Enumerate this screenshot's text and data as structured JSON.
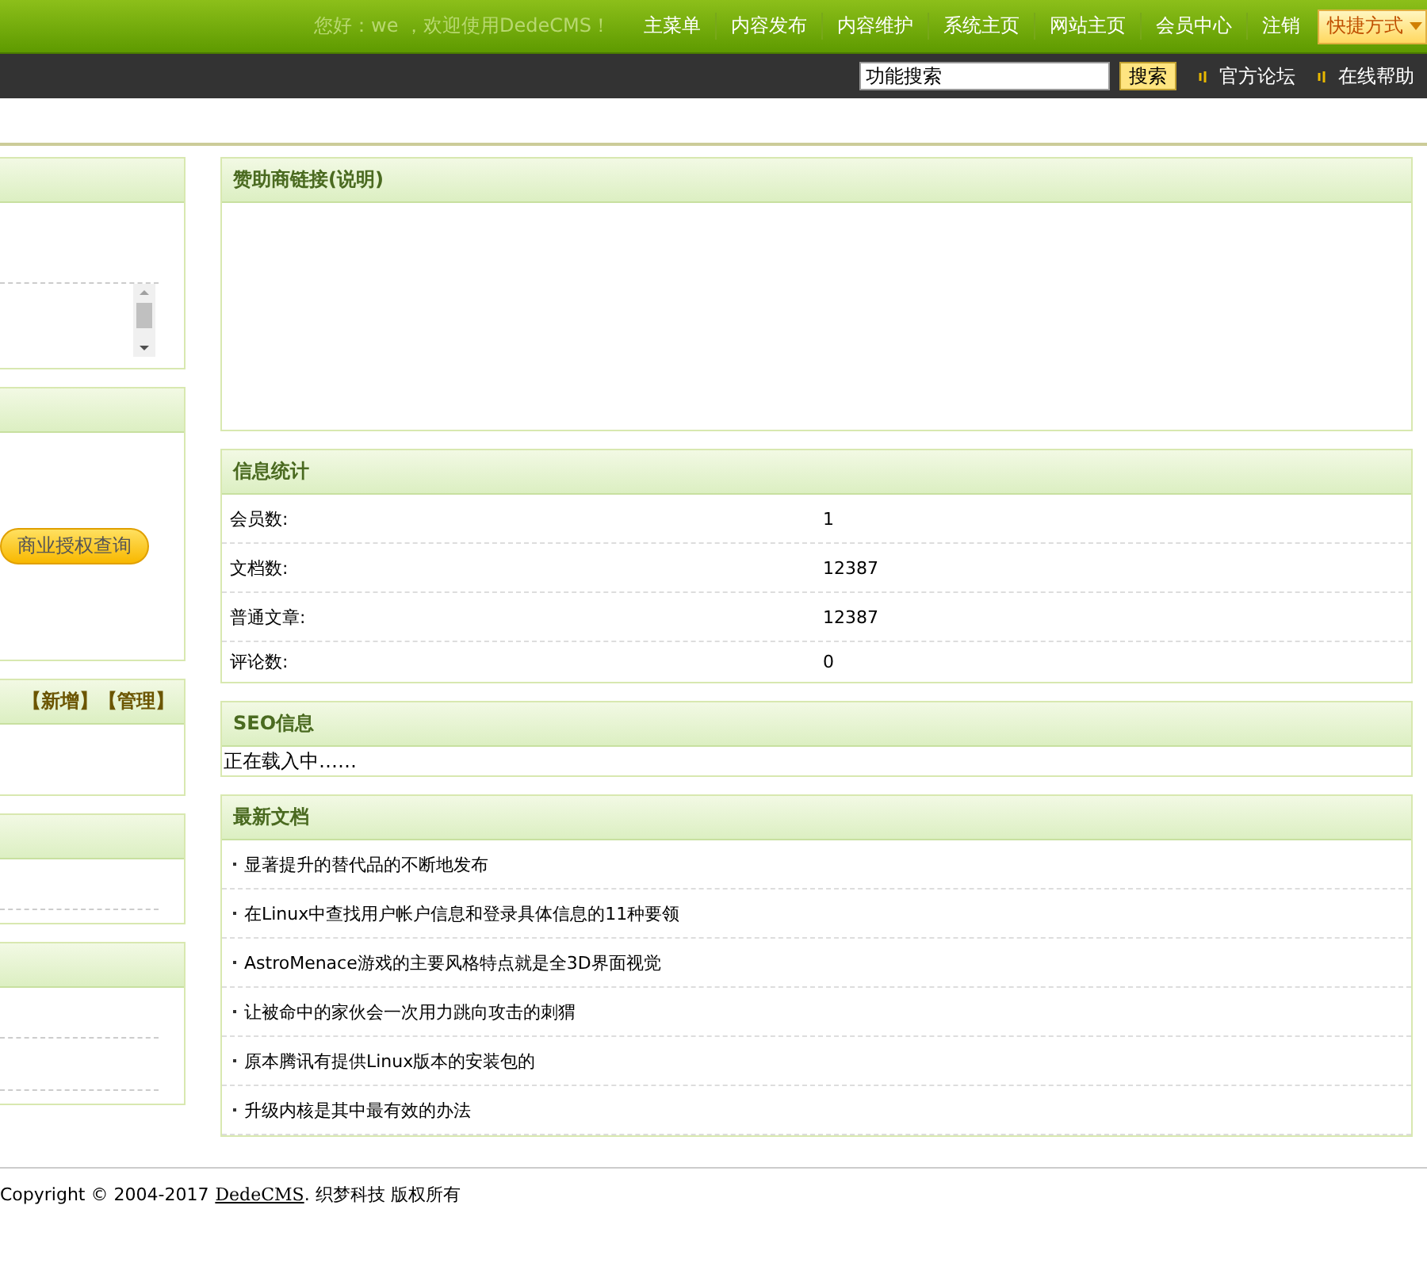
{
  "header": {
    "greeting": "您好：we ，欢迎使用DedeCMS！",
    "nav": [
      "主菜单",
      "内容发布",
      "内容维护",
      "系统主页",
      "网站主页",
      "会员中心",
      "注销"
    ],
    "shortcut": "快捷方式"
  },
  "toolbar": {
    "search_value": "功能搜索",
    "search_button": "搜索",
    "links": [
      "官方论坛",
      "在线帮助"
    ]
  },
  "left_panels": [
    {
      "kind": "scroll"
    },
    {
      "kind": "button",
      "button": "商业授权查询"
    },
    {
      "kind": "actions",
      "actions": [
        "【新增】",
        "【管理】"
      ]
    },
    {
      "kind": "single-row"
    },
    {
      "kind": "double-row"
    }
  ],
  "sponsor": {
    "title": "赞助商链接(说明)"
  },
  "stats": {
    "title": "信息统计",
    "rows": [
      {
        "label": "会员数:",
        "value": "1"
      },
      {
        "label": "文档数:",
        "value": "12387"
      },
      {
        "label": "普通文章:",
        "value": "12387"
      },
      {
        "label": "评论数:",
        "value": "0"
      }
    ]
  },
  "seo": {
    "title": "SEO信息",
    "text": "正在载入中……"
  },
  "latest": {
    "title": "最新文档",
    "items": [
      "显著提升的替代品的不断地发布",
      "在Linux中查找用户帐户信息和登录具体信息的11种要领",
      "AstroMenace游戏的主要风格特点就是全3D界面视觉",
      "让被命中的家伙会一次用力跳向攻击的刺猬",
      "原本腾讯有提供Linux版本的安装包的",
      "升级内核是其中最有效的办法"
    ]
  },
  "footer": {
    "copyright": "Copyright © 2004-2017",
    "link": "DedeCMS",
    "suffix": ". 织梦科技 版权所有"
  }
}
